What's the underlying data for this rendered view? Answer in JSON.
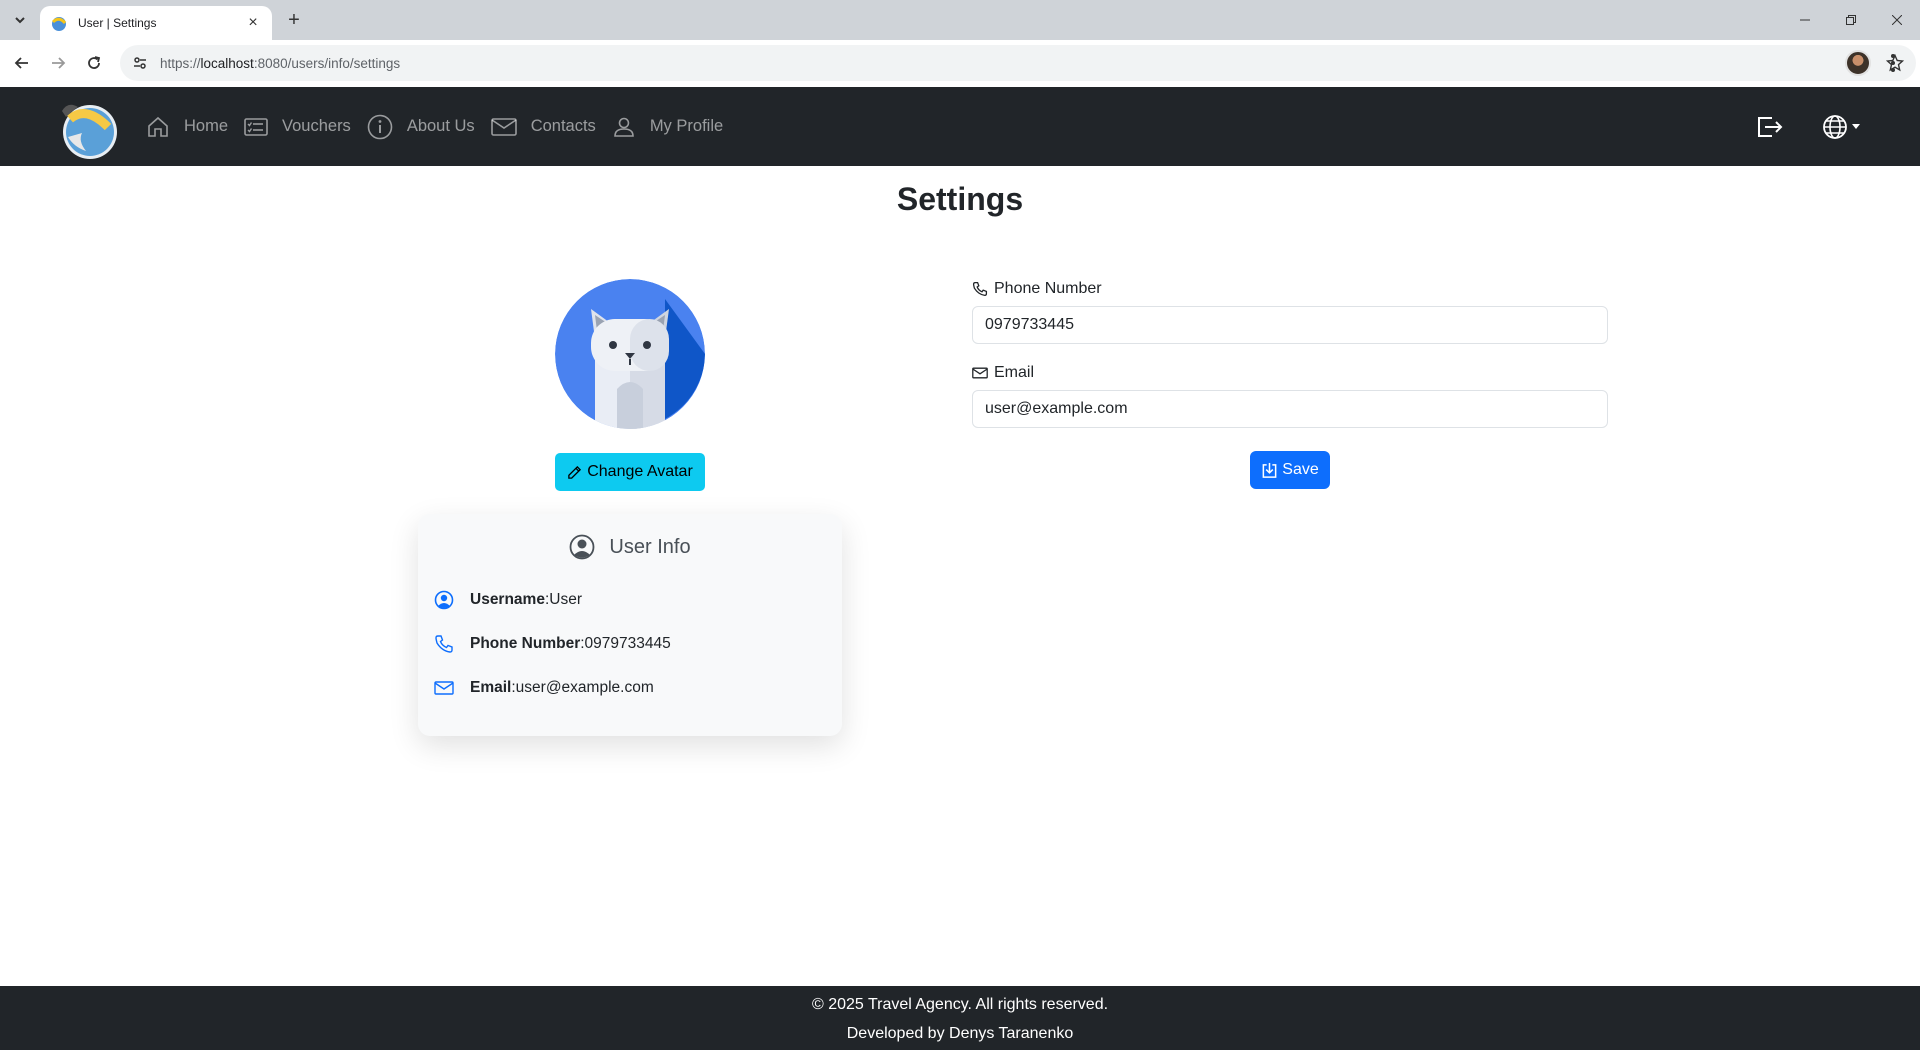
{
  "browser": {
    "tab_title": "User | Settings",
    "url_scheme": "https://",
    "url_host": "localhost",
    "url_rest": ":8080/users/info/settings"
  },
  "navbar": {
    "items": [
      {
        "label": "Home",
        "icon": "house-icon"
      },
      {
        "label": "Vouchers",
        "icon": "card-list-icon"
      },
      {
        "label": "About Us",
        "icon": "info-circle-icon"
      },
      {
        "label": "Contacts",
        "icon": "envelope-icon"
      },
      {
        "label": "My Profile",
        "icon": "person-icon"
      }
    ],
    "right_icons": [
      "logout-icon",
      "globe-icon"
    ]
  },
  "page": {
    "title": "Settings"
  },
  "avatar": {
    "change_label": "Change Avatar"
  },
  "user_info": {
    "title": "User Info",
    "rows": [
      {
        "label": "Username",
        "value": "User",
        "icon": "person-circle-icon"
      },
      {
        "label": "Phone Number",
        "value": "0979733445",
        "icon": "telephone-icon"
      },
      {
        "label": "Email",
        "value": "user@example.com",
        "icon": "envelope-icon"
      }
    ]
  },
  "form": {
    "phone_label": "Phone Number",
    "phone_value": "0979733445",
    "email_label": "Email",
    "email_value": "user@example.com",
    "save_label": "Save"
  },
  "footer": {
    "copyright": "© 2025 Travel Agency. All rights reserved.",
    "developer": "Developed by Denys Taranenko"
  },
  "colors": {
    "navbar_bg": "#212529",
    "info_button": "#0dcaf0",
    "primary_button": "#0d6efd",
    "icon_blue": "#0d6efd"
  }
}
